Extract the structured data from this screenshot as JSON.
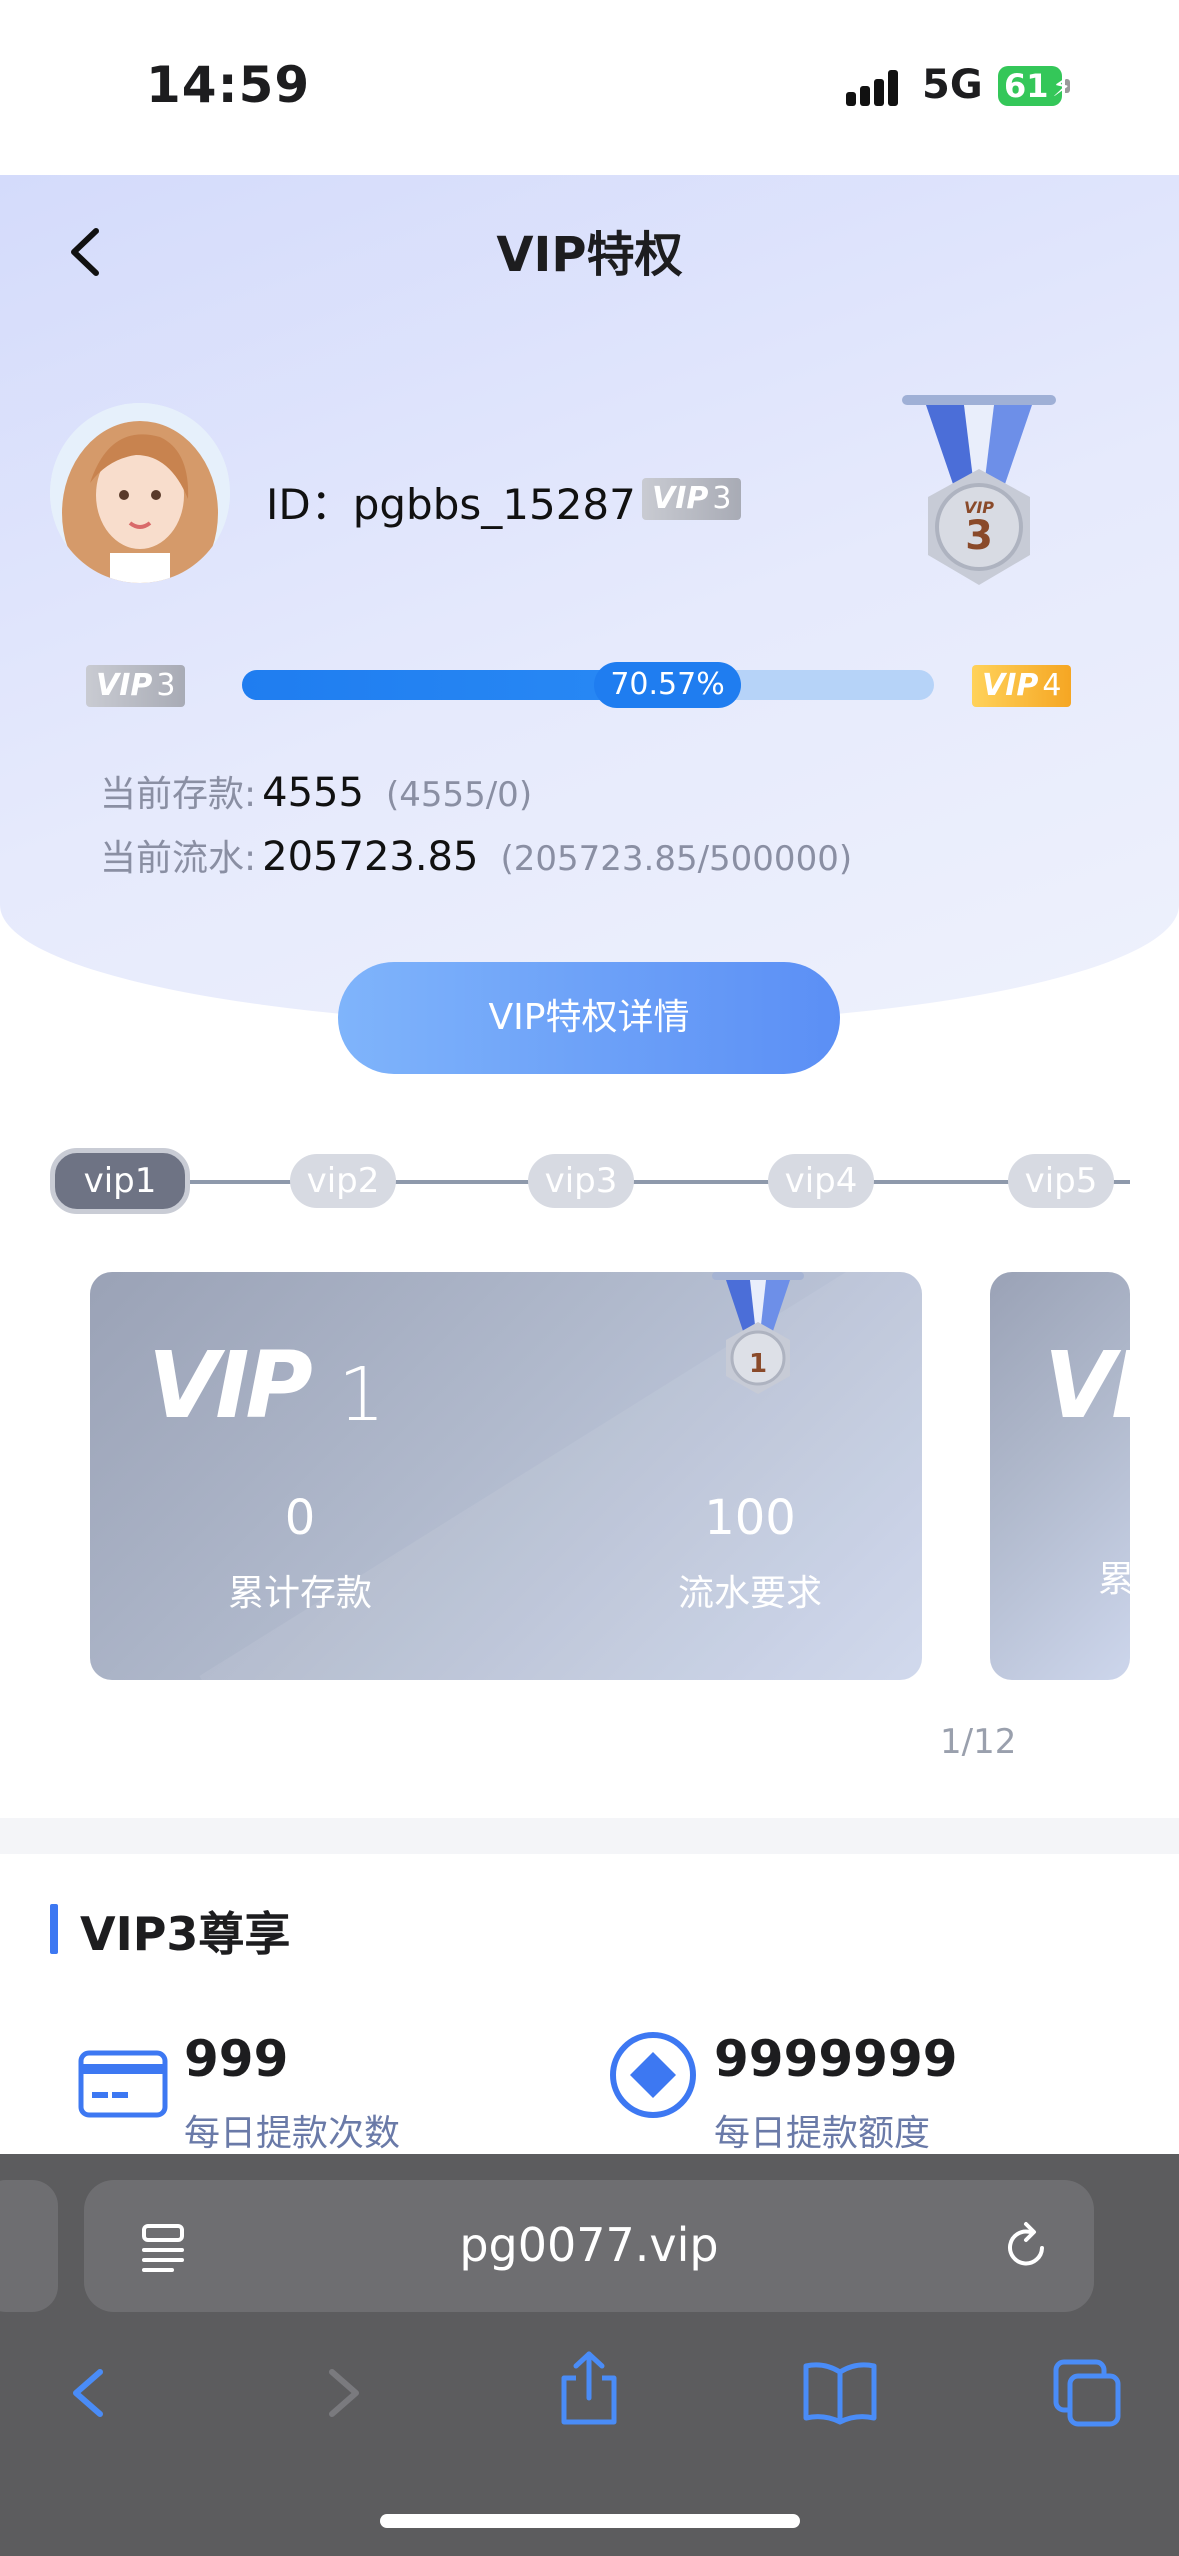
{
  "status_bar": {
    "time": "14:59",
    "network": "5G",
    "battery": "61"
  },
  "header": {
    "title": "VIP特权"
  },
  "profile": {
    "user_id": "ID：pgbbs_15287",
    "badge_label": "VIP",
    "badge_level": "3",
    "medal_level": "3",
    "medal_vip_text": "VIP"
  },
  "progress": {
    "current_label": "VIP",
    "current_level": "3",
    "next_label": "VIP",
    "next_level": "4",
    "percent_text": "70.57%",
    "fraction": 0.7057
  },
  "stats": {
    "deposit_label": "当前存款:",
    "deposit_value": "4555",
    "deposit_detail": "(4555/0)",
    "turnover_label": "当前流水:",
    "turnover_value": "205723.85",
    "turnover_detail": "(205723.85/500000)"
  },
  "detail_button": "VIP特权详情",
  "levels": [
    "vip1",
    "vip2",
    "vip3",
    "vip4",
    "vip5"
  ],
  "vip_card": {
    "vip_text": "VIP",
    "level": "1",
    "medal_level": "1",
    "deposit_value": "0",
    "deposit_label": "累计存款",
    "turnover_value": "100",
    "turnover_label": "流水要求",
    "peek_vip_text": "VI",
    "peek_label": "累"
  },
  "pager": "1/12",
  "section": {
    "title": "VIP3尊享",
    "perks": [
      {
        "value": "999",
        "label": "每日提款次数",
        "icon": "card-icon"
      },
      {
        "value": "9999999",
        "label": "每日提款额度",
        "icon": "diamond-icon"
      }
    ]
  },
  "browser": {
    "url": "pg0077.vip"
  },
  "colors": {
    "accent": "#1f7df0",
    "section_bar": "#3d78f2",
    "progress_track": "#b6d3f8"
  }
}
